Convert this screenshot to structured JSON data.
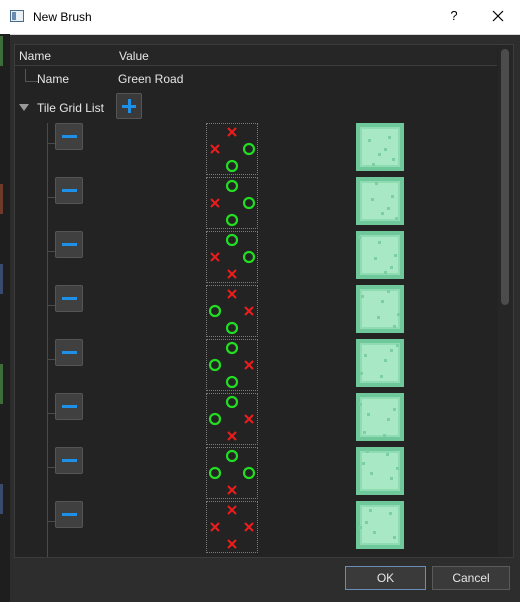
{
  "window": {
    "title": "New Brush",
    "help_label": "?"
  },
  "tree": {
    "columns": [
      "Name",
      "Value"
    ],
    "name_row": {
      "label": "Name",
      "value": "Green Road"
    },
    "list_row": {
      "label": "Tile Grid List"
    }
  },
  "tile_grids": [
    {
      "cells": [
        "",
        "x",
        "",
        "x",
        "",
        "o",
        "",
        "o",
        ""
      ]
    },
    {
      "cells": [
        "",
        "o",
        "",
        "x",
        "",
        "o",
        "",
        "o",
        ""
      ]
    },
    {
      "cells": [
        "",
        "o",
        "",
        "x",
        "",
        "o",
        "",
        "x",
        ""
      ]
    },
    {
      "cells": [
        "",
        "x",
        "",
        "o",
        "",
        "x",
        "",
        "o",
        ""
      ]
    },
    {
      "cells": [
        "",
        "o",
        "",
        "o",
        "",
        "x",
        "",
        "o",
        ""
      ]
    },
    {
      "cells": [
        "",
        "o",
        "",
        "o",
        "",
        "x",
        "",
        "x",
        ""
      ]
    },
    {
      "cells": [
        "",
        "o",
        "",
        "o",
        "",
        "o",
        "",
        "x",
        ""
      ]
    },
    {
      "cells": [
        "",
        "x",
        "",
        "x",
        "",
        "x",
        "",
        "x",
        ""
      ]
    }
  ],
  "buttons": {
    "ok": "OK",
    "cancel": "Cancel"
  },
  "icons": {
    "add": "plus-icon",
    "remove": "minus-icon",
    "close": "close-icon",
    "expand": "triangle-down-icon",
    "allowed": "green-circle-icon",
    "blocked": "red-x-icon"
  },
  "colors": {
    "accent": "#1e90e8",
    "allowed": "#22dd22",
    "blocked": "#ee1c1c",
    "tile": "#8fdcb2",
    "background": "#2d2d2d"
  }
}
